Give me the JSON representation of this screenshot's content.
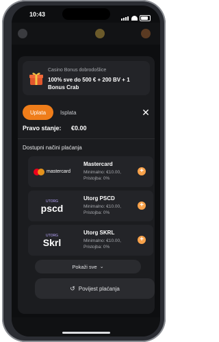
{
  "status": {
    "time": "10:43"
  },
  "promo": {
    "title": "Casino Bonus dobrodošlice",
    "text": "100% sve do 500 € + 200 BV + 1 Bonus Crab"
  },
  "tabs": [
    {
      "label": "Uplata",
      "active": true
    },
    {
      "label": "Isplata",
      "active": false
    }
  ],
  "balance": {
    "label": "Pravo stanje:",
    "value": "€0.00"
  },
  "section_title": "Dostupni načini plaćanja",
  "methods": [
    {
      "name": "Mastercard",
      "min": "Minimalno: €10.00,",
      "fee": "Pristojba: 0%",
      "logo_text": "mastercard"
    },
    {
      "name": "Utorg PSCD",
      "min": "Minimalno: €10.00,",
      "fee": "Pristojba: 0%",
      "logo_small": "UTORG",
      "logo_text": "pscd"
    },
    {
      "name": "Utorg SKRL",
      "min": "Minimalno: €10.00,",
      "fee": "Pristojba: 0%",
      "logo_small": "UTORG",
      "logo_text": "Skrl"
    }
  ],
  "show_all": "Pokaži sve",
  "history": "Povijest plaćanja",
  "colors": {
    "accent": "#ef7d1a",
    "plus": "#f7a14a",
    "panel": "#1b1c1f",
    "card": "#232428"
  }
}
